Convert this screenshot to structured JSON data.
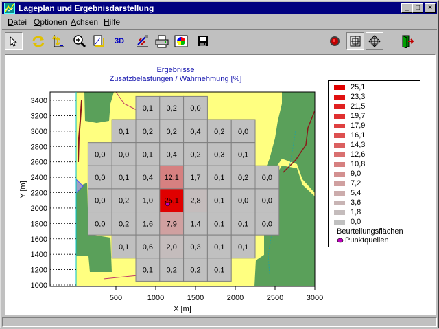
{
  "window": {
    "title": "Lageplan und Ergebnisdarstellung"
  },
  "titlebar_buttons": {
    "minimize": "_",
    "maximize": "□",
    "close": "×"
  },
  "menu": [
    {
      "label": "Datei",
      "accel": "D",
      "rest": "atei"
    },
    {
      "label": "Optionen",
      "accel": "O",
      "rest": "ptionen"
    },
    {
      "label": "Achsen",
      "accel": "A",
      "rest": "chsen"
    },
    {
      "label": "Hilfe",
      "accel": "H",
      "rest": "ilfe"
    }
  ],
  "toolbar": [
    {
      "name": "select-arrow-icon",
      "pressed": true
    },
    {
      "name": "refresh-icon"
    },
    {
      "name": "axis-scale-icon"
    },
    {
      "name": "zoom-in-icon"
    },
    {
      "name": "page-setup-icon"
    },
    {
      "name": "view-3d-button",
      "text": "3D"
    },
    {
      "name": "edit-legend-icon"
    },
    {
      "name": "print-icon"
    },
    {
      "name": "color-palette-icon"
    },
    {
      "name": "save-icon"
    },
    {
      "name": "record-icon"
    },
    {
      "name": "grid-view-icon",
      "pressed": true
    },
    {
      "name": "pan-icon"
    },
    {
      "name": "exit-icon"
    }
  ],
  "chart": {
    "title_line1": "Ergebnisse",
    "title_line2": "Zusatzbelastungen / Wahrnehmung [%]",
    "xlabel": "X [m]",
    "ylabel": "Y [m]",
    "x_ticks": [
      "500",
      "1000",
      "1500",
      "2000",
      "2500",
      "3000"
    ],
    "y_ticks": [
      "1000",
      "1200",
      "1400",
      "1600",
      "1800",
      "2000",
      "2200",
      "2400",
      "2600",
      "2800",
      "3000",
      "3200",
      "3400"
    ]
  },
  "chart_data": {
    "type": "heatmap",
    "title": "Ergebnisse\nZusatzbelastungen / Wahrnehmung [%]",
    "xlabel": "X [m]",
    "ylabel": "Y [m]",
    "xlim": [
      0,
      3000
    ],
    "ylim": [
      1000,
      3500
    ],
    "cell_size_m": 300,
    "x_cell_origins": [
      150,
      450,
      750,
      1050,
      1350,
      1650,
      1950,
      2250
    ],
    "y_cell_origins": [
      3300,
      3000,
      2700,
      2400,
      2100,
      1800,
      1500,
      1200
    ],
    "grid": [
      [
        null,
        null,
        "0,1",
        "0,2",
        "0,0",
        null,
        null,
        null
      ],
      [
        null,
        "0,1",
        "0,2",
        "0,2",
        "0,4",
        "0,2",
        "0,0",
        null
      ],
      [
        "0,0",
        "0,0",
        "0,1",
        "0,4",
        "0,2",
        "0,3",
        "0,1",
        null
      ],
      [
        "0,0",
        "0,1",
        "0,4",
        "12,1",
        "1,7",
        "0,1",
        "0,2",
        "0,0"
      ],
      [
        "0,0",
        "0,2",
        "1,0",
        "25,1",
        "2,8",
        "0,1",
        "0,0",
        "0,0"
      ],
      [
        "0,0",
        "0,2",
        "1,6",
        "7,9",
        "1,4",
        "0,1",
        "0,1",
        "0,0"
      ],
      [
        null,
        "0,1",
        "0,6",
        "2,0",
        "0,3",
        "0,1",
        "0,1",
        null
      ],
      [
        null,
        null,
        "0,1",
        "0,2",
        "0,2",
        "0,1",
        null,
        null
      ]
    ],
    "point_source": {
      "x": 1150,
      "y": 2050
    }
  },
  "legend": {
    "items": [
      {
        "label": "25,1",
        "color": "#e00000"
      },
      {
        "label": "23,3",
        "color": "#e01010"
      },
      {
        "label": "21,5",
        "color": "#e02020"
      },
      {
        "label": "19,7",
        "color": "#e03030"
      },
      {
        "label": "17,9",
        "color": "#df4040"
      },
      {
        "label": "16,1",
        "color": "#dd5050"
      },
      {
        "label": "14,3",
        "color": "#db6060"
      },
      {
        "label": "12,6",
        "color": "#d97070"
      },
      {
        "label": "10,8",
        "color": "#d68080"
      },
      {
        "label": "9,0",
        "color": "#d39090"
      },
      {
        "label": "7,2",
        "color": "#d0a0a0"
      },
      {
        "label": "5,4",
        "color": "#ccacac"
      },
      {
        "label": "3,6",
        "color": "#c8b4b4"
      },
      {
        "label": "1,8",
        "color": "#c4bcbc"
      },
      {
        "label": "0,0",
        "color": "#c0c0c0"
      }
    ],
    "area_label": "Beurteilungsflächen",
    "source_label": "Punktquellen",
    "source_color": "#c000c0"
  }
}
